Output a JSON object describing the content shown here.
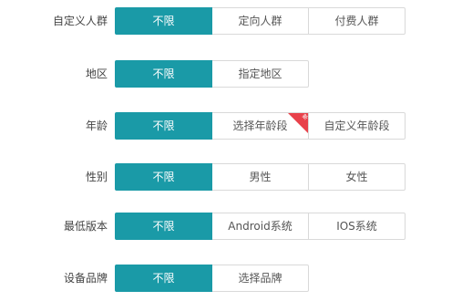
{
  "colors": {
    "active": "#1a9aa7",
    "border": "#d9d9d9",
    "badge": "#e8414a"
  },
  "rows": [
    {
      "label": "自定义人群",
      "options": [
        {
          "label": "不限",
          "selected": true
        },
        {
          "label": "定向人群"
        },
        {
          "label": "付费人群"
        }
      ]
    },
    {
      "label": "地区",
      "options": [
        {
          "label": "不限",
          "selected": true
        },
        {
          "label": "指定地区"
        }
      ]
    },
    {
      "label": "年龄",
      "options": [
        {
          "label": "不限",
          "selected": true
        },
        {
          "label": "选择年龄段",
          "badge": "新"
        },
        {
          "label": "自定义年龄段"
        }
      ]
    },
    {
      "label": "性别",
      "options": [
        {
          "label": "不限",
          "selected": true
        },
        {
          "label": "男性"
        },
        {
          "label": "女性"
        }
      ]
    },
    {
      "label": "最低版本",
      "options": [
        {
          "label": "不限",
          "selected": true
        },
        {
          "label": "Android系统"
        },
        {
          "label": "IOS系统"
        }
      ]
    },
    {
      "label": "设备品牌",
      "options": [
        {
          "label": "不限",
          "selected": true
        },
        {
          "label": "选择品牌"
        }
      ]
    }
  ]
}
